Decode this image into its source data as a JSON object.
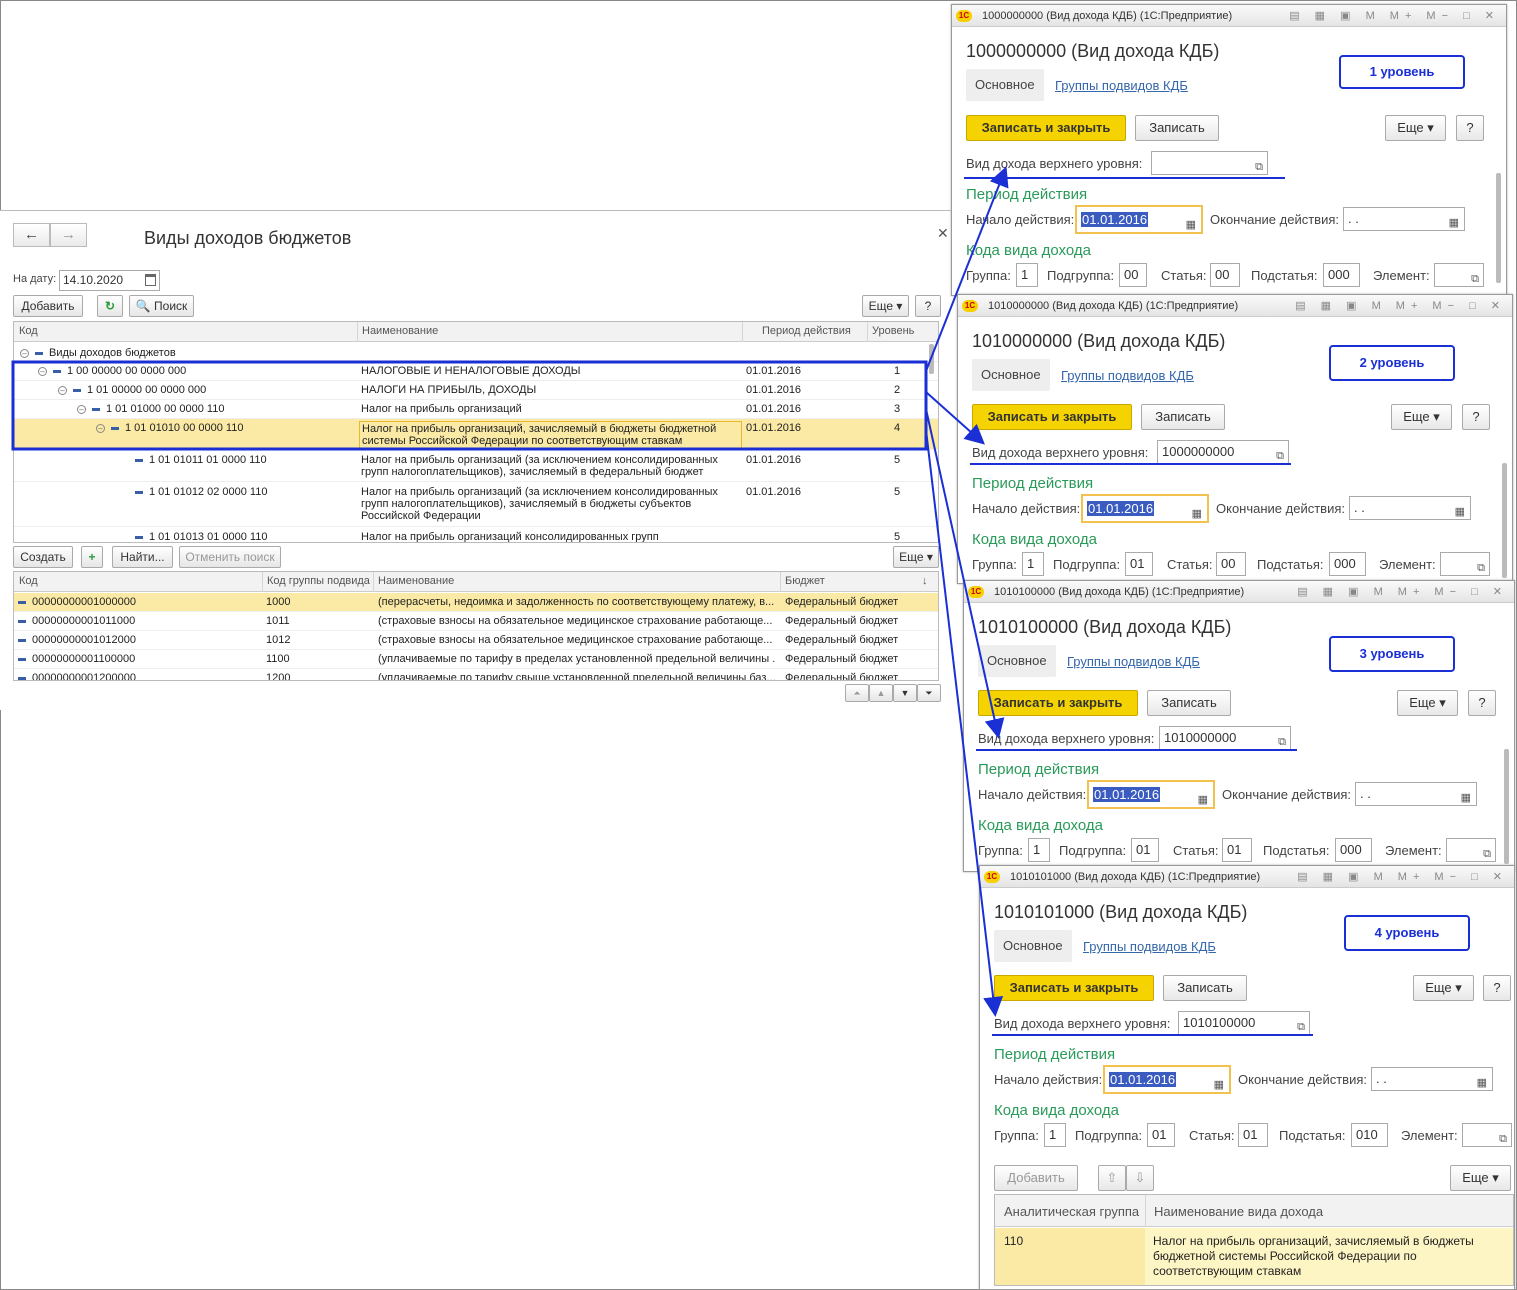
{
  "main": {
    "title": "Виды доходов бюджетов",
    "back_icon": "arrow-left-icon",
    "fwd_icon": "arrow-right-icon",
    "date_label": "На дату:",
    "date_value": "14.10.2020",
    "add": "Добавить",
    "search": "Поиск",
    "more": "Еще",
    "help": "?",
    "cols": [
      "Код",
      "Наименование",
      "Период действия",
      "Уровень"
    ],
    "root": "Виды доходов бюджетов",
    "rows": [
      {
        "code": "1 00 00000 00 0000 000",
        "name": "НАЛОГОВЫЕ И НЕНАЛОГОВЫЕ ДОХОДЫ",
        "period": "01.01.2016",
        "level": "1"
      },
      {
        "code": "1 01 00000 00 0000 000",
        "name": "НАЛОГИ НА ПРИБЫЛЬ, ДОХОДЫ",
        "period": "01.01.2016",
        "level": "2"
      },
      {
        "code": "1 01 01000 00 0000 110",
        "name": "Налог на прибыль организаций",
        "period": "01.01.2016",
        "level": "3"
      },
      {
        "code": "1 01 01010 00 0000 110",
        "name": "Налог на прибыль организаций, зачисляемый в бюджеты бюджетной системы Российской Федерации по соответствующим ставкам",
        "period": "01.01.2016",
        "level": "4"
      },
      {
        "code": "1 01 01011 01 0000 110",
        "name": "Налог на прибыль организаций (за исключением консолидированных групп налогоплательщиков), зачисляемый в федеральный бюджет",
        "period": "01.01.2016",
        "level": "5"
      },
      {
        "code": "1 01 01012 02 0000 110",
        "name": "Налог на прибыль организаций (за исключением консолидированных групп налогоплательщиков), зачисляемый в бюджеты субъектов Российской Федерации",
        "period": "01.01.2016",
        "level": "5"
      },
      {
        "code": "1 01 01013 01 0000 110",
        "name": "Налог на прибыль организаций консолидированных групп",
        "period": "",
        "level": "5"
      }
    ],
    "sub": {
      "create": "Создать",
      "find": "Найти...",
      "cancel_find": "Отменить поиск",
      "more": "Еще",
      "cols": [
        "Код",
        "Код группы подвида",
        "Наименование",
        "Бюджет"
      ],
      "rows": [
        {
          "code": "00000000001000000",
          "grp": "1000",
          "name": "(перерасчеты, недоимка и задолженность по соответствующему платежу, в...",
          "budget": "Федеральный бюджет"
        },
        {
          "code": "00000000001011000",
          "grp": "1011",
          "name": "(страховые взносы на обязательное медицинское страхование работающе...",
          "budget": "Федеральный бюджет"
        },
        {
          "code": "00000000001012000",
          "grp": "1012",
          "name": "(страховые взносы на обязательное медицинское страхование работающе...",
          "budget": "Федеральный бюджет"
        },
        {
          "code": "00000000001100000",
          "grp": "1100",
          "name": "(уплачиваемые по тарифу в пределах установленной предельной величины ...",
          "budget": "Федеральный бюджет"
        },
        {
          "code": "00000000001200000",
          "grp": "1200",
          "name": "(уплачиваемые по тарифу свыше установленной предельной величины баз...",
          "budget": "Федеральный бюджет"
        }
      ]
    }
  },
  "forms": [
    {
      "wtitle": "1000000000 (Вид дохода КДБ) (1С:Предприятие)",
      "heading": "1000000000 (Вид дохода КДБ)",
      "badge": "1 уровень",
      "parent": "",
      "group": "1",
      "subgroup": "00",
      "article": "00",
      "subarticle": "000",
      "element": ""
    },
    {
      "wtitle": "1010000000 (Вид дохода КДБ) (1С:Предприятие)",
      "heading": "1010000000 (Вид дохода КДБ)",
      "badge": "2 уровень",
      "parent": "1000000000",
      "group": "1",
      "subgroup": "01",
      "article": "00",
      "subarticle": "000",
      "element": ""
    },
    {
      "wtitle": "1010100000 (Вид дохода КДБ) (1С:Предприятие)",
      "heading": "1010100000 (Вид дохода КДБ)",
      "badge": "3 уровень",
      "parent": "1010000000",
      "group": "1",
      "subgroup": "01",
      "article": "01",
      "subarticle": "000",
      "element": ""
    },
    {
      "wtitle": "1010101000 (Вид дохода КДБ) (1С:Предприятие)",
      "heading": "1010101000 (Вид дохода КДБ)",
      "badge": "4 уровень",
      "parent": "1010100000",
      "group": "1",
      "subgroup": "01",
      "article": "01",
      "subarticle": "010",
      "element": ""
    }
  ],
  "form_labels": {
    "tab_main": "Основное",
    "tab_groups": "Группы подвидов КДБ",
    "save_close": "Записать и закрыть",
    "save": "Записать",
    "more": "Еще",
    "help": "?",
    "parent_label": "Вид дохода верхнего уровня:",
    "period_section": "Период действия",
    "start_label": "Начало действия:",
    "start_value": "01.01.2016",
    "end_label": "Окончание действия:",
    "end_value": " .  .",
    "codes_section": "Кода вида дохода",
    "group": "Группа:",
    "subgroup": "Подгруппа:",
    "article": "Статья:",
    "subarticle": "Подстатья:",
    "element": "Элемент:"
  },
  "analytics": {
    "add": "Добавить",
    "more": "Еще",
    "cols": [
      "Аналитическая группа",
      "Наименование вида дохода"
    ],
    "row": {
      "grp": "110",
      "name": "Налог на прибыль организаций, зачисляемый в бюджеты бюджетной системы Российской Федерации по соответствующим ставкам"
    }
  },
  "colors": {
    "annotation": "#1a2fd4",
    "yellow_button": "#f5d300",
    "section_green": "#2a9a5a",
    "link": "#3366aa",
    "selection": "#fbeaa5"
  }
}
